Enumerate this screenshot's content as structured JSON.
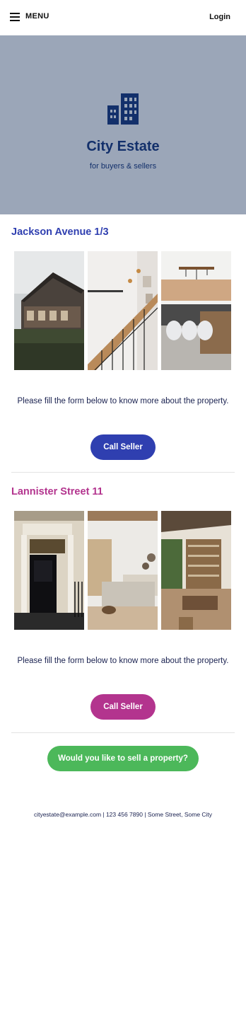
{
  "header": {
    "menu_label": "MENU",
    "login_label": "Login"
  },
  "hero": {
    "title": "City Estate",
    "tagline": "for buyers & sellers",
    "bg_color": "#9ba6b8",
    "logo_icon": "buildings-icon"
  },
  "properties": [
    {
      "title": "Jackson Avenue 1/3",
      "accent": "#2f3fb0",
      "description": "Please fill the form below to know more about the property.",
      "button_label": "Call Seller",
      "photos": [
        "house-exterior",
        "staircase-interior",
        "dining-kitchen"
      ]
    },
    {
      "title": "Lannister Street 11",
      "accent": "#b3348e",
      "description": "Please fill the form below to know more about the property.",
      "button_label": "Call Seller",
      "photos": [
        "black-front-door",
        "bedroom-interior",
        "boho-living-room"
      ]
    }
  ],
  "sell_cta": {
    "label": "Would you like to sell a property?",
    "color": "#4cb85a"
  },
  "footer": {
    "text": "cityestate@example.com | 123 456 7890 | Some Street, Some City"
  }
}
